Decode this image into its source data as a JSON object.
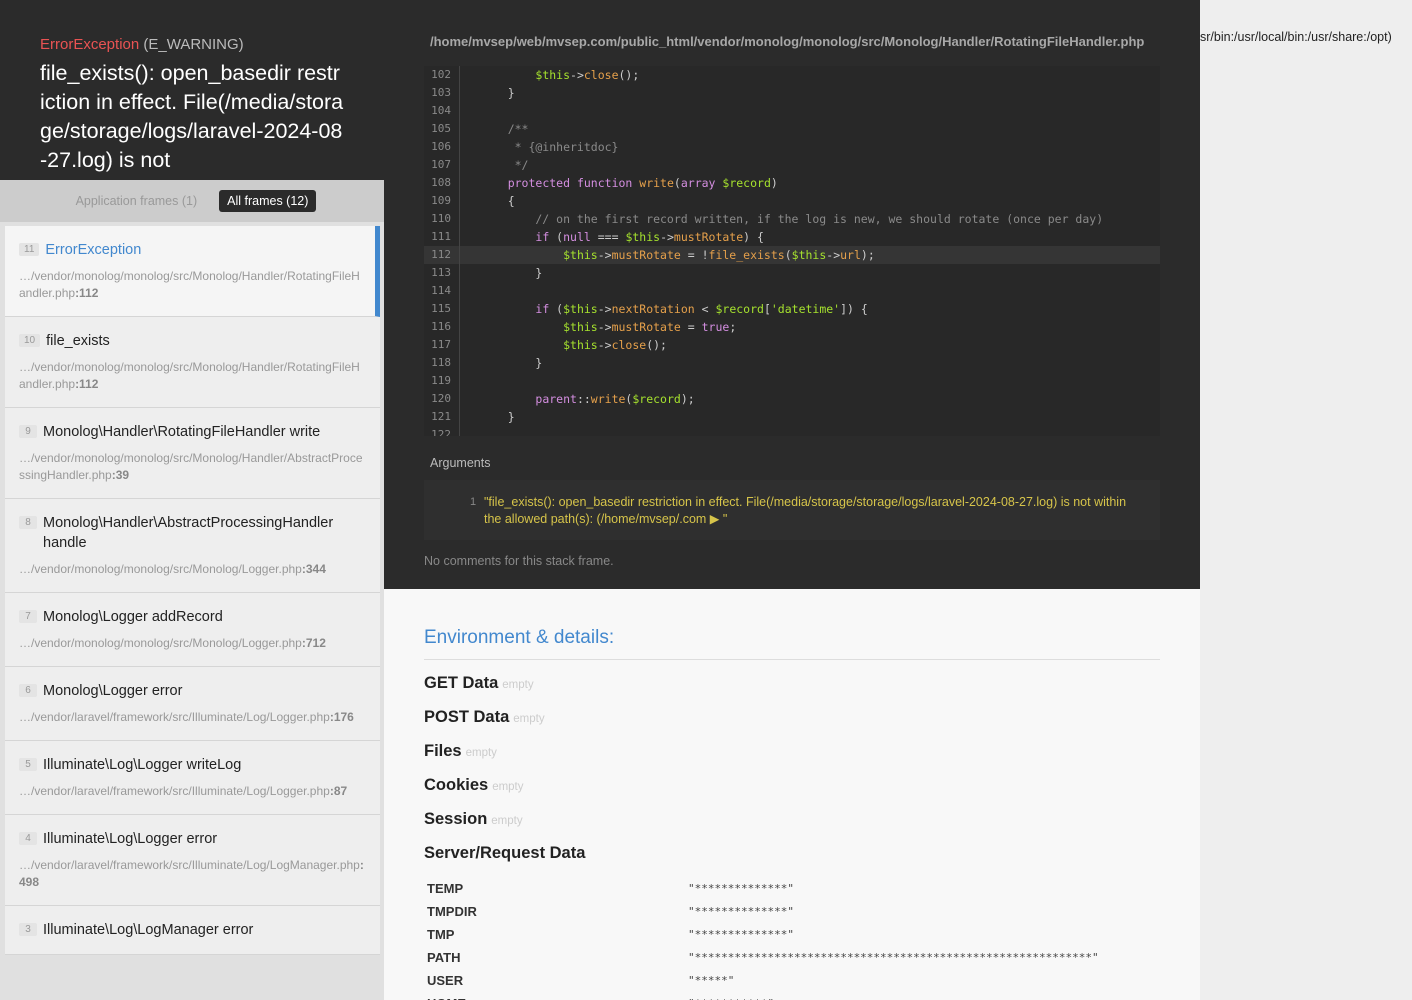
{
  "header": {
    "exception_class": "ErrorException",
    "exception_type": "(E_WARNING)",
    "message": "file_exists(): open_basedir restriction in effect. File(/media/storage/storage/logs/laravel-2024-08-27.log) is not"
  },
  "frame_tabs": {
    "application": "Application frames (1)",
    "all": "All frames (12)"
  },
  "frames": [
    {
      "index": "11",
      "class": "ErrorException",
      "path": "…/vendor/monolog/monolog/src/Monolog/Handler/RotatingFileHandler.php",
      "line": ":112"
    },
    {
      "index": "10",
      "class": "file_exists",
      "path": "…/vendor/monolog/monolog/src/Monolog/Handler/RotatingFileHandler.php",
      "line": ":112"
    },
    {
      "index": "9",
      "class": "Monolog\\Handler\\RotatingFileHandler write",
      "path": "…/vendor/monolog/monolog/src/Monolog/Handler/AbstractProcessingHandler.php",
      "line": ":39"
    },
    {
      "index": "8",
      "class": "Monolog\\Handler\\AbstractProcessingHandler handle",
      "path": "…/vendor/monolog/monolog/src/Monolog/Logger.php",
      "line": ":344"
    },
    {
      "index": "7",
      "class": "Monolog\\Logger addRecord",
      "path": "…/vendor/monolog/monolog/src/Monolog/Logger.php",
      "line": ":712"
    },
    {
      "index": "6",
      "class": "Monolog\\Logger error",
      "path": "…/vendor/laravel/framework/src/Illuminate/Log/Logger.php",
      "line": ":176"
    },
    {
      "index": "5",
      "class": "Illuminate\\Log\\Logger writeLog",
      "path": "…/vendor/laravel/framework/src/Illuminate/Log/Logger.php",
      "line": ":87"
    },
    {
      "index": "4",
      "class": "Illuminate\\Log\\Logger error",
      "path": "…/vendor/laravel/framework/src/Illuminate/Log/LogManager.php",
      "line": ":498"
    },
    {
      "index": "3",
      "class": "Illuminate\\Log\\LogManager error",
      "path": "",
      "line": ""
    }
  ],
  "code_view": {
    "file_path": "/home/mvsep/web/mvsep.com/public_html/vendor/monolog/monolog/src/Monolog/Handler/RotatingFileHandler.php",
    "lines": [
      {
        "n": "102",
        "text": "        $this->close();"
      },
      {
        "n": "103",
        "text": "    }"
      },
      {
        "n": "104",
        "text": ""
      },
      {
        "n": "105",
        "text": "    /**"
      },
      {
        "n": "106",
        "text": "     * {@inheritdoc}"
      },
      {
        "n": "107",
        "text": "     */"
      },
      {
        "n": "108",
        "text": "    protected function write(array $record)"
      },
      {
        "n": "109",
        "text": "    {"
      },
      {
        "n": "110",
        "text": "        // on the first record written, if the log is new, we should rotate (once per day)"
      },
      {
        "n": "111",
        "text": "        if (null === $this->mustRotate) {"
      },
      {
        "n": "112",
        "text": "            $this->mustRotate = !file_exists($this->url);"
      },
      {
        "n": "113",
        "text": "        }"
      },
      {
        "n": "114",
        "text": ""
      },
      {
        "n": "115",
        "text": "        if ($this->nextRotation < $record['datetime']) {"
      },
      {
        "n": "116",
        "text": "            $this->mustRotate = true;"
      },
      {
        "n": "117",
        "text": "            $this->close();"
      },
      {
        "n": "118",
        "text": "        }"
      },
      {
        "n": "119",
        "text": ""
      },
      {
        "n": "120",
        "text": "        parent::write($record);"
      },
      {
        "n": "121",
        "text": "    }"
      },
      {
        "n": "122",
        "text": ""
      }
    ],
    "highlight_line": "112"
  },
  "arguments": {
    "label": "Arguments",
    "index": "1",
    "value": "\"file_exists(): open_basedir restriction in effect. File(/media/storage/storage/logs/laravel-2024-08-27.log) is not within the allowed path(s): (/home/mvsep/.com ▶ \""
  },
  "no_comments": "No comments for this stack frame.",
  "env": {
    "title": "Environment & details:",
    "sections": [
      {
        "name": "GET Data",
        "status": "empty"
      },
      {
        "name": "POST Data",
        "status": "empty"
      },
      {
        "name": "Files",
        "status": "empty"
      },
      {
        "name": "Cookies",
        "status": "empty"
      },
      {
        "name": "Session",
        "status": "empty"
      },
      {
        "name": "Server/Request Data",
        "status": ""
      }
    ],
    "server_rows": [
      {
        "key": "TEMP",
        "value": "\"**************\""
      },
      {
        "key": "TMPDIR",
        "value": "\"**************\""
      },
      {
        "key": "TMP",
        "value": "\"**************\""
      },
      {
        "key": "PATH",
        "value": "\"************************************************************\""
      },
      {
        "key": "USER",
        "value": "\"*****\""
      },
      {
        "key": "HOME",
        "value": "\"***********\""
      }
    ]
  },
  "overflow_text": "sr/bin:/usr/local/bin:/usr/share:/opt)"
}
